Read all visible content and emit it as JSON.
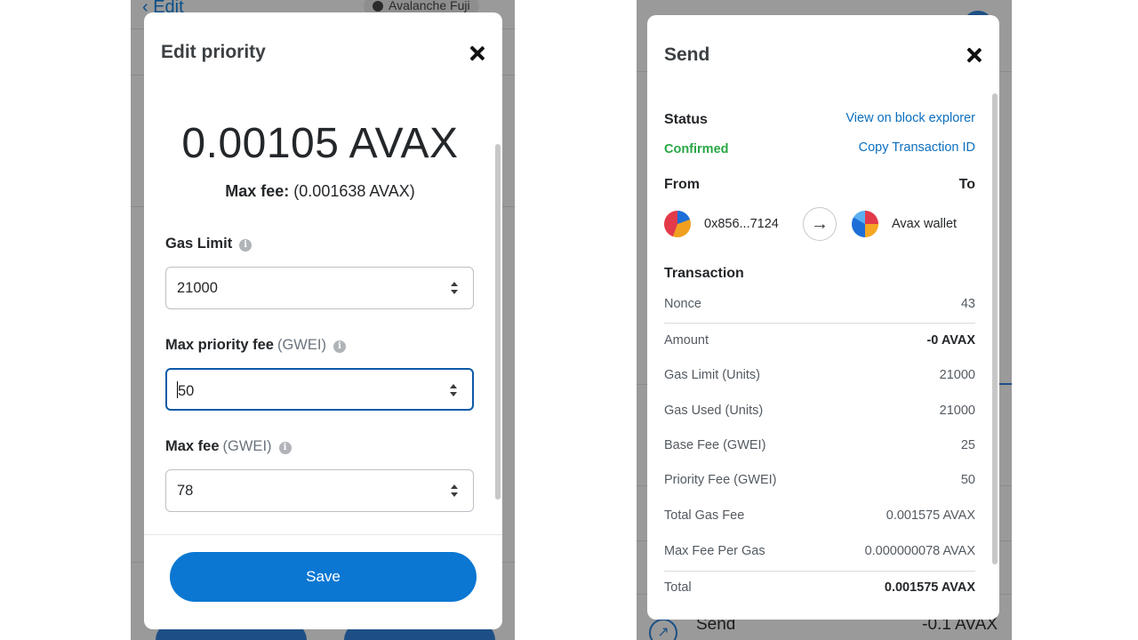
{
  "background_left": {
    "back_label": "‹ Edit",
    "network_label": "Avalanche Fuji"
  },
  "edit_priority": {
    "title": "Edit priority",
    "fee_amount": "0.00105 AVAX",
    "max_fee_label": "Max fee:",
    "max_fee_value": "(0.001638 AVAX)",
    "gas_limit": {
      "label": "Gas Limit",
      "value": "21000"
    },
    "max_priority_fee": {
      "label": "Max priority fee",
      "unit": "(GWEI)",
      "value": "50"
    },
    "max_fee": {
      "label": "Max fee",
      "unit": "(GWEI)",
      "value": "78"
    },
    "save_label": "Save"
  },
  "send": {
    "title": "Send",
    "status_label": "Status",
    "status_value": "Confirmed",
    "view_explorer": "View on block explorer",
    "copy_tx": "Copy Transaction ID",
    "from_label": "From",
    "to_label": "To",
    "from_address": "0x856...7124",
    "to_name": "Avax wallet",
    "transaction_label": "Transaction",
    "rows": [
      {
        "label": "Nonce",
        "value": "43"
      },
      {
        "label": "Amount",
        "value": "-0 AVAX"
      },
      {
        "label": "Gas Limit (Units)",
        "value": "21000"
      },
      {
        "label": "Gas Used (Units)",
        "value": "21000"
      },
      {
        "label": "Base Fee (GWEI)",
        "value": "25"
      },
      {
        "label": "Priority Fee (GWEI)",
        "value": "50"
      },
      {
        "label": "Total Gas Fee",
        "value": "0.001575 AVAX"
      },
      {
        "label": "Max Fee Per Gas",
        "value": "0.000000078 AVAX"
      },
      {
        "label": "Total",
        "value": "0.001575 AVAX"
      }
    ]
  },
  "background_right": {
    "send_label": "Send",
    "send_amount": "-0.1 AVAX"
  },
  "colors": {
    "primary": "#0b77d2",
    "link": "#0c6fbf",
    "confirmed": "#28a745",
    "overlay": "#9a9a9a"
  }
}
